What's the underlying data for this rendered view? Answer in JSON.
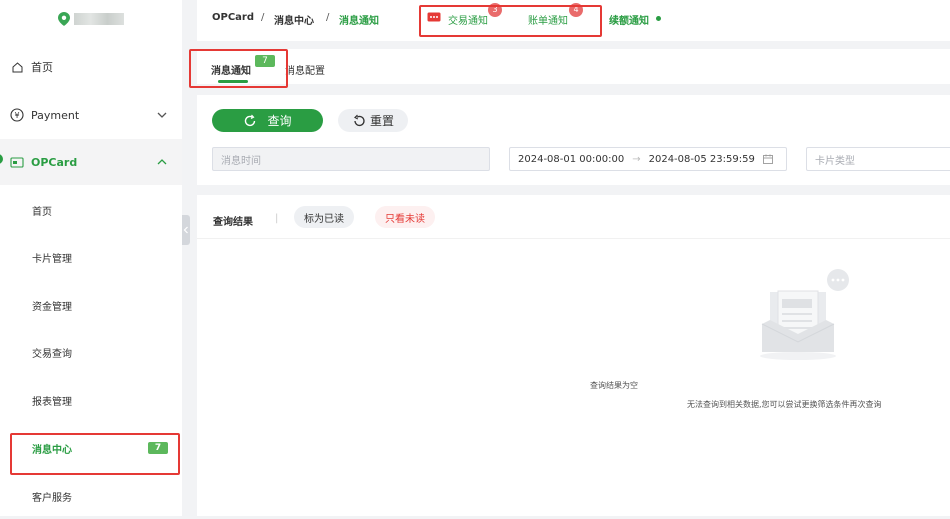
{
  "sidebar": {
    "items": {
      "home": "首页",
      "payment": "Payment",
      "opcard": "OPCard"
    },
    "sub_items": [
      "首页",
      "卡片管理",
      "资金管理",
      "交易查询",
      "报表管理",
      "消息中心",
      "客户服务"
    ],
    "msg_badge": "7"
  },
  "breadcrumb": {
    "root": "OPCard",
    "sep": "/",
    "middle": "消息中心",
    "current": "消息通知"
  },
  "notifications": {
    "trade_label": "交易通知",
    "trade_count": "3",
    "bill_label": "账单通知",
    "bill_count": "4",
    "renew_label": "续额通知"
  },
  "tabs": {
    "notice": "消息通知",
    "notice_badge": "7",
    "config": "消息配置"
  },
  "filters": {
    "query_label": "查询",
    "reset_label": "重置",
    "msg_time_placeholder": "消息时间",
    "date_start": "2024-08-01 00:00:00",
    "date_arrow": "→",
    "date_end": "2024-08-05 23:59:59",
    "card_type_placeholder": "卡片类型"
  },
  "results": {
    "title": "查询结果",
    "sep": "|",
    "mark_read": "标为已读",
    "unread_only": "只看未读",
    "empty_title": "查询结果为空",
    "empty_sub": "无法查询到相关数据,您可以尝试更换筛选条件再次查询"
  },
  "colors": {
    "brand_green": "#2a9d43",
    "alert_red": "#e53935"
  }
}
